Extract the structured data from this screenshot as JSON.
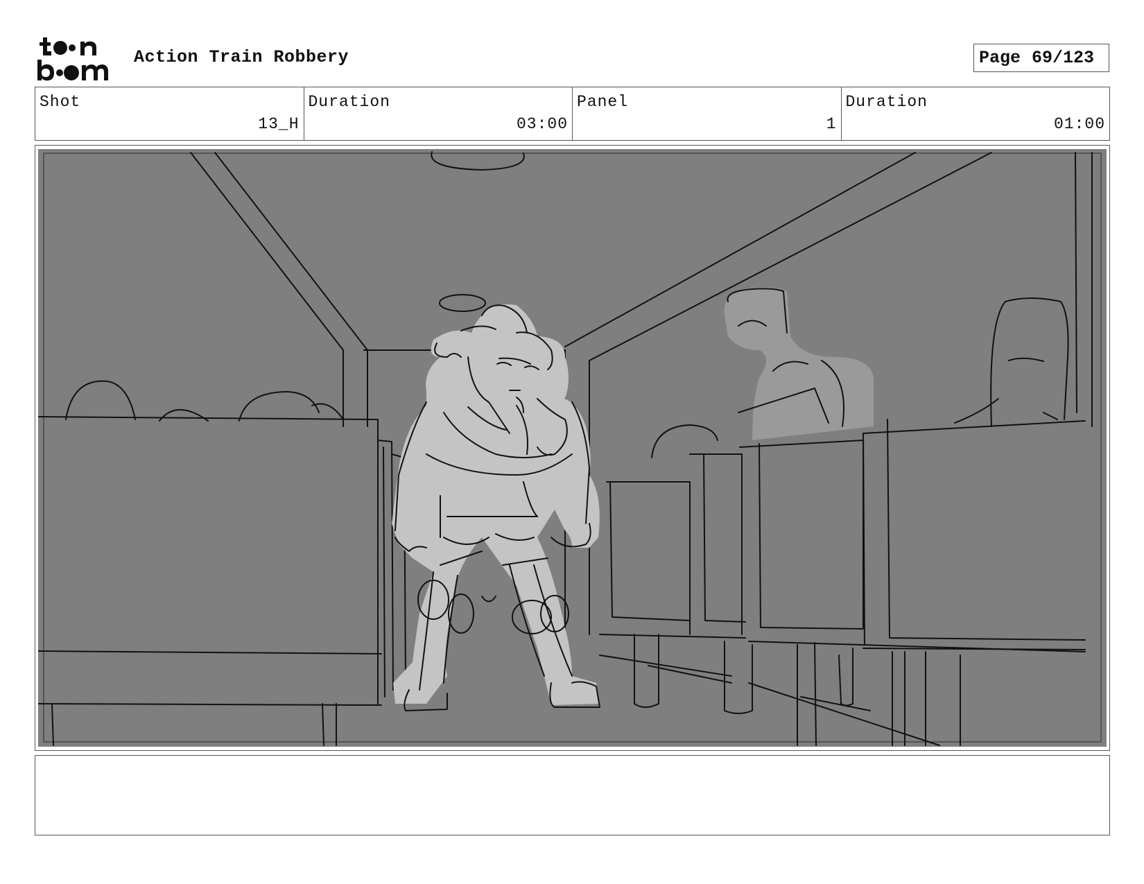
{
  "header": {
    "title": "Action Train Robbery",
    "page_label": "Page",
    "page_number": "69/123"
  },
  "info": {
    "shot_label": "Shot",
    "shot_value": "13_H",
    "shot_duration_label": "Duration",
    "shot_duration_value": "03:00",
    "panel_label": "Panel",
    "panel_value": "1",
    "panel_duration_label": "Duration",
    "panel_duration_value": "01:00"
  },
  "notes": {
    "text": ""
  },
  "colors": {
    "panel_background": "#7f7f7f",
    "figure_fill": "#c4c4c4",
    "passenger_fill": "#9a9a9a",
    "line": "#111111",
    "border": "#555555"
  }
}
